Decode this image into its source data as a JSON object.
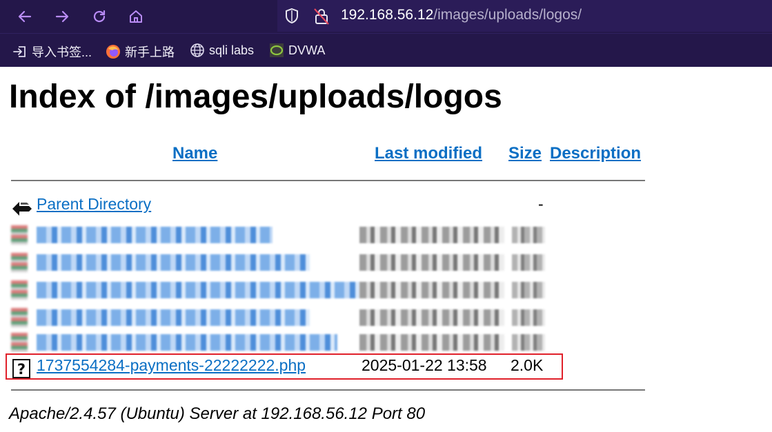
{
  "browser": {
    "url_host": "192.168.56.12",
    "url_path": "/images/uploads/logos/",
    "bookmarks": [
      {
        "label": "导入书签...",
        "icon": "import-icon"
      },
      {
        "label": "新手上路",
        "icon": "firefox-icon"
      },
      {
        "label": "sqli labs",
        "icon": "globe-icon"
      },
      {
        "label": "DVWA",
        "icon": "dvwa-icon"
      }
    ],
    "colors": {
      "toolbar": "#24174a",
      "urlbar": "#2b1c58",
      "nav_icons": "#b98cf7"
    }
  },
  "listing": {
    "title": "Index of /images/uploads/logos",
    "columns": {
      "name": "Name",
      "last_modified": "Last modified",
      "size": "Size",
      "description": "Description"
    },
    "parent": {
      "name": "Parent Directory",
      "size": "-",
      "icon": "back-icon"
    },
    "highlighted_file": {
      "name": "1737554284-payments-22222222.php",
      "last_modified": "2025-01-22 13:58",
      "size": "2.0K",
      "icon": "unknown-file-icon"
    },
    "highlight_color": "#e0202a"
  },
  "footer": "Apache/2.4.57 (Ubuntu) Server at 192.168.56.12 Port 80"
}
